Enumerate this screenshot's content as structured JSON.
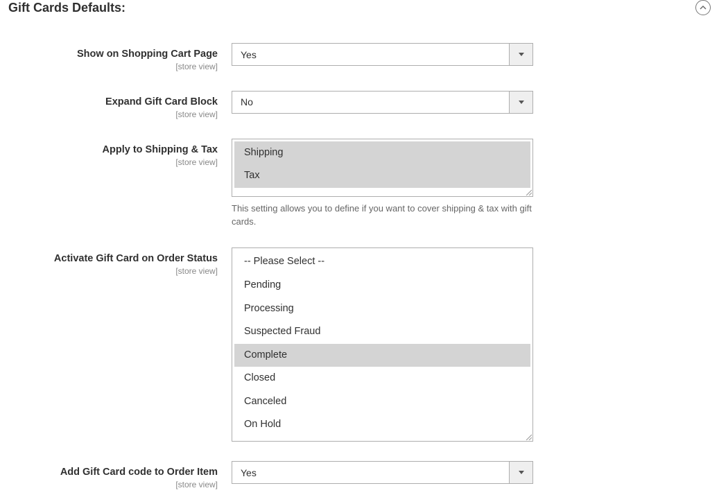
{
  "section": {
    "title": "Gift Cards Defaults:"
  },
  "fields": {
    "show_on_cart": {
      "label": "Show on Shopping Cart Page",
      "scope": "[store view]",
      "value": "Yes"
    },
    "expand_block": {
      "label": "Expand Gift Card Block",
      "scope": "[store view]",
      "value": "No"
    },
    "apply_shipping_tax": {
      "label": "Apply to Shipping & Tax",
      "scope": "[store view]",
      "options": {
        "shipping": "Shipping",
        "tax": "Tax"
      },
      "help": "This setting allows you to define if you want to cover shipping & tax with gift cards."
    },
    "activate_status": {
      "label": "Activate Gift Card on Order Status",
      "scope": "[store view]",
      "options": {
        "placeholder": "-- Please Select --",
        "pending": "Pending",
        "processing": "Processing",
        "fraud": "Suspected Fraud",
        "complete": "Complete",
        "closed": "Closed",
        "canceled": "Canceled",
        "onhold": "On Hold"
      }
    },
    "add_code_order_item": {
      "label": "Add Gift Card code to Order Item",
      "scope": "[store view]",
      "value": "Yes"
    }
  }
}
